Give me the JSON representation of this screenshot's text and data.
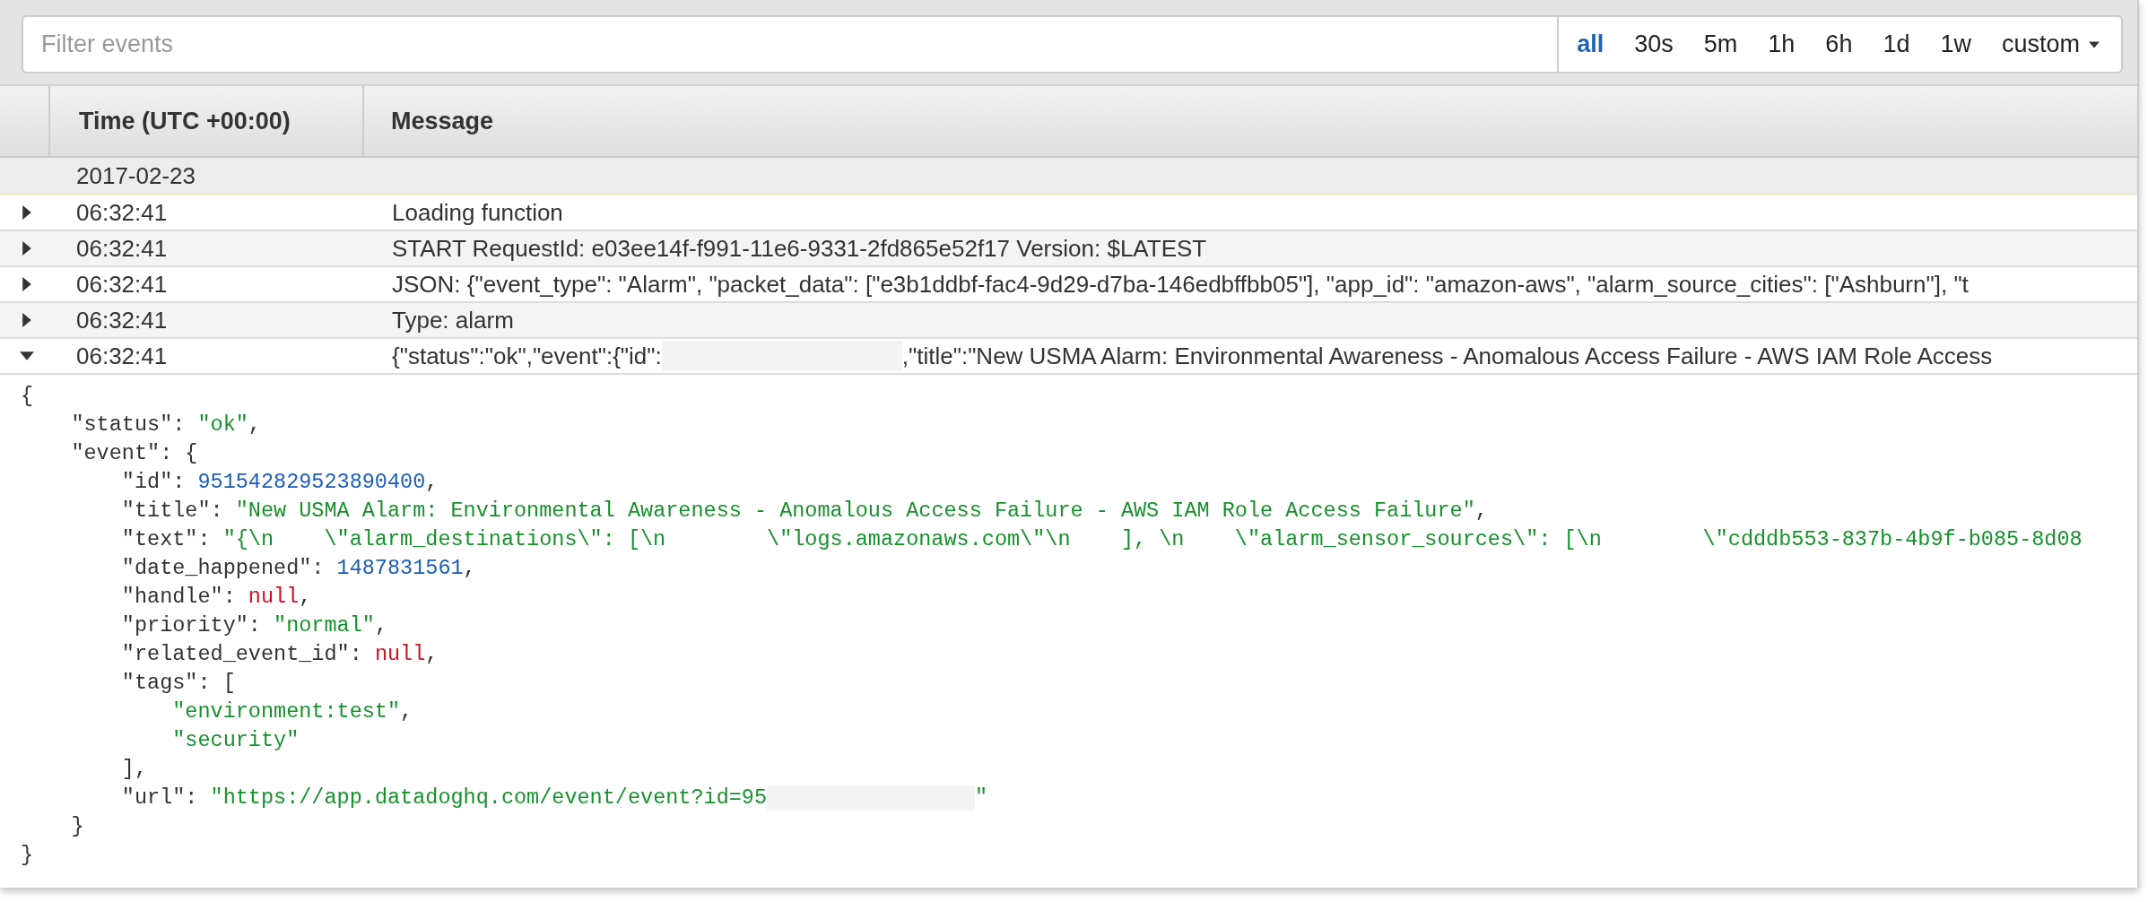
{
  "filter": {
    "placeholder": "Filter events"
  },
  "ranges": [
    {
      "label": "all",
      "selected": true,
      "kind": "link"
    },
    {
      "label": "30s",
      "selected": false,
      "kind": "link"
    },
    {
      "label": "5m",
      "selected": false,
      "kind": "link"
    },
    {
      "label": "1h",
      "selected": false,
      "kind": "link"
    },
    {
      "label": "6h",
      "selected": false,
      "kind": "link"
    },
    {
      "label": "1d",
      "selected": false,
      "kind": "link"
    },
    {
      "label": "1w",
      "selected": false,
      "kind": "link"
    },
    {
      "label": "custom",
      "selected": false,
      "kind": "dropdown"
    }
  ],
  "table": {
    "columns": [
      "Time (UTC +00:00)",
      "Message"
    ],
    "date_group": "2017-02-23",
    "rows": [
      {
        "time": "06:32:41",
        "expanded": false,
        "message": [
          {
            "kind": "text",
            "text": "Loading function"
          }
        ]
      },
      {
        "time": "06:32:41",
        "expanded": false,
        "message": [
          {
            "kind": "text",
            "text": "START RequestId: e03ee14f-f991-11e6-9331-2fd865e52f17 Version: $LATEST"
          }
        ]
      },
      {
        "time": "06:32:41",
        "expanded": false,
        "message": [
          {
            "kind": "text",
            "text": "JSON: {\"event_type\": \"Alarm\", \"packet_data\": [\"e3b1ddbf-fac4-9d29-d7ba-146edbffbb05\"], \"app_id\": \"amazon-aws\", \"alarm_source_cities\": [\"Ashburn\"], \"t"
          }
        ]
      },
      {
        "time": "06:32:41",
        "expanded": false,
        "message": [
          {
            "kind": "text",
            "text": "Type: alarm"
          }
        ]
      },
      {
        "time": "06:32:41",
        "expanded": true,
        "message": [
          {
            "kind": "text",
            "text": "{\"status\":\"ok\",\"event\":{\"id\":"
          },
          {
            "kind": "redacted"
          },
          {
            "kind": "text",
            "text": ",\"title\":\"New USMA Alarm: Environmental Awareness - Anomalous Access Failure - AWS IAM Role Access"
          }
        ]
      }
    ]
  },
  "detail": {
    "lines": [
      [
        {
          "kind": "plain",
          "text": "{"
        }
      ],
      [
        {
          "kind": "plain",
          "text": "    \"status\": "
        },
        {
          "kind": "string",
          "text": "\"ok\""
        },
        {
          "kind": "plain",
          "text": ","
        }
      ],
      [
        {
          "kind": "plain",
          "text": "    \"event\": {"
        }
      ],
      [
        {
          "kind": "plain",
          "text": "        \"id\": "
        },
        {
          "kind": "number",
          "text": "951542829523890400"
        },
        {
          "kind": "plain",
          "text": ","
        }
      ],
      [
        {
          "kind": "plain",
          "text": "        \"title\": "
        },
        {
          "kind": "string",
          "text": "\"New USMA Alarm: Environmental Awareness - Anomalous Access Failure - AWS IAM Role Access Failure\""
        },
        {
          "kind": "plain",
          "text": ","
        }
      ],
      [
        {
          "kind": "plain",
          "text": "        \"text\": "
        },
        {
          "kind": "string",
          "text": "\"{\\n    \\\"alarm_destinations\\\": [\\n        \\\"logs.amazonaws.com\\\"\\n    ], \\n    \\\"alarm_sensor_sources\\\": [\\n        \\\"cdddb553-837b-4b9f-b085-8d08"
        }
      ],
      [
        {
          "kind": "plain",
          "text": "        \"date_happened\": "
        },
        {
          "kind": "number",
          "text": "1487831561"
        },
        {
          "kind": "plain",
          "text": ","
        }
      ],
      [
        {
          "kind": "plain",
          "text": "        \"handle\": "
        },
        {
          "kind": "null",
          "text": "null"
        },
        {
          "kind": "plain",
          "text": ","
        }
      ],
      [
        {
          "kind": "plain",
          "text": "        \"priority\": "
        },
        {
          "kind": "string",
          "text": "\"normal\""
        },
        {
          "kind": "plain",
          "text": ","
        }
      ],
      [
        {
          "kind": "plain",
          "text": "        \"related_event_id\": "
        },
        {
          "kind": "null",
          "text": "null"
        },
        {
          "kind": "plain",
          "text": ","
        }
      ],
      [
        {
          "kind": "plain",
          "text": "        \"tags\": ["
        }
      ],
      [
        {
          "kind": "string",
          "text": "            \"environment:test\""
        },
        {
          "kind": "plain",
          "text": ","
        }
      ],
      [
        {
          "kind": "string",
          "text": "            \"security\""
        }
      ],
      [
        {
          "kind": "plain",
          "text": "        ],"
        }
      ],
      [
        {
          "kind": "plain",
          "text": "        \"url\": "
        },
        {
          "kind": "string",
          "text": "\"https://app.datadoghq.com/event/event?id=95"
        },
        {
          "kind": "redacted"
        },
        {
          "kind": "string",
          "text": "\""
        }
      ],
      [
        {
          "kind": "plain",
          "text": "    }"
        }
      ],
      [
        {
          "kind": "plain",
          "text": "}"
        }
      ]
    ]
  }
}
